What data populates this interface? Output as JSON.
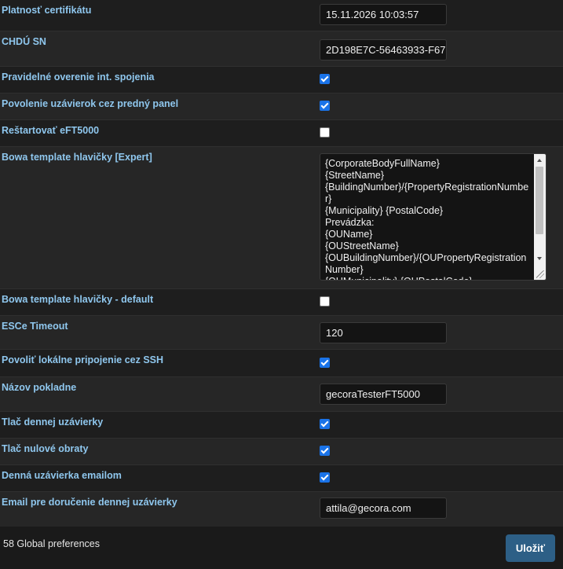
{
  "settings": [
    {
      "label": "Platnosť certifikátu",
      "type": "text",
      "value": "15.11.2026 10:03:57"
    },
    {
      "label": "CHDÚ SN",
      "type": "text",
      "value": "2D198E7C-56463933-F67"
    },
    {
      "label": "Pravidelné overenie int. spojenia",
      "type": "checkbox",
      "checked": true
    },
    {
      "label": "Povolenie uzávierok cez predný panel",
      "type": "checkbox",
      "checked": true
    },
    {
      "label": "Reštartovať eFT5000",
      "type": "checkbox",
      "checked": false
    },
    {
      "label": "Bowa template hlavičky [Expert]",
      "type": "textarea",
      "value": "{CorporateBodyFullName}\n{StreetName}\n{BuildingNumber}/{PropertyRegistrationNumber}\n{Municipality} {PostalCode}\nPrevádzka:\n{OUName}\n{OUStreetName}\n{OUBuildingNumber}/{OUPropertyRegistrationNumber}\n{OUMunicipality} {OUPostalCode}"
    },
    {
      "label": "Bowa template hlavičky - default",
      "type": "checkbox",
      "checked": false
    },
    {
      "label": "ESCe Timeout",
      "type": "text",
      "value": "120"
    },
    {
      "label": "Povoliť lokálne pripojenie cez SSH",
      "type": "checkbox",
      "checked": true
    },
    {
      "label": "Názov pokladne",
      "type": "text",
      "value": "gecoraTesterFT5000"
    },
    {
      "label": "Tlač dennej uzávierky",
      "type": "checkbox",
      "checked": true
    },
    {
      "label": "Tlač nulové obraty",
      "type": "checkbox",
      "checked": true
    },
    {
      "label": "Denná uzávierka emailom",
      "type": "checkbox",
      "checked": true
    },
    {
      "label": "Email pre doručenie dennej uzávierky",
      "type": "text",
      "value": "attila@gecora.com"
    }
  ],
  "footer": {
    "count_text": "58 Global preferences",
    "save_label": "Uložiť"
  },
  "colors": {
    "label": "#8fc7ee",
    "checkbox_checked": "#1a73e8",
    "save_button": "#2d5f86"
  }
}
